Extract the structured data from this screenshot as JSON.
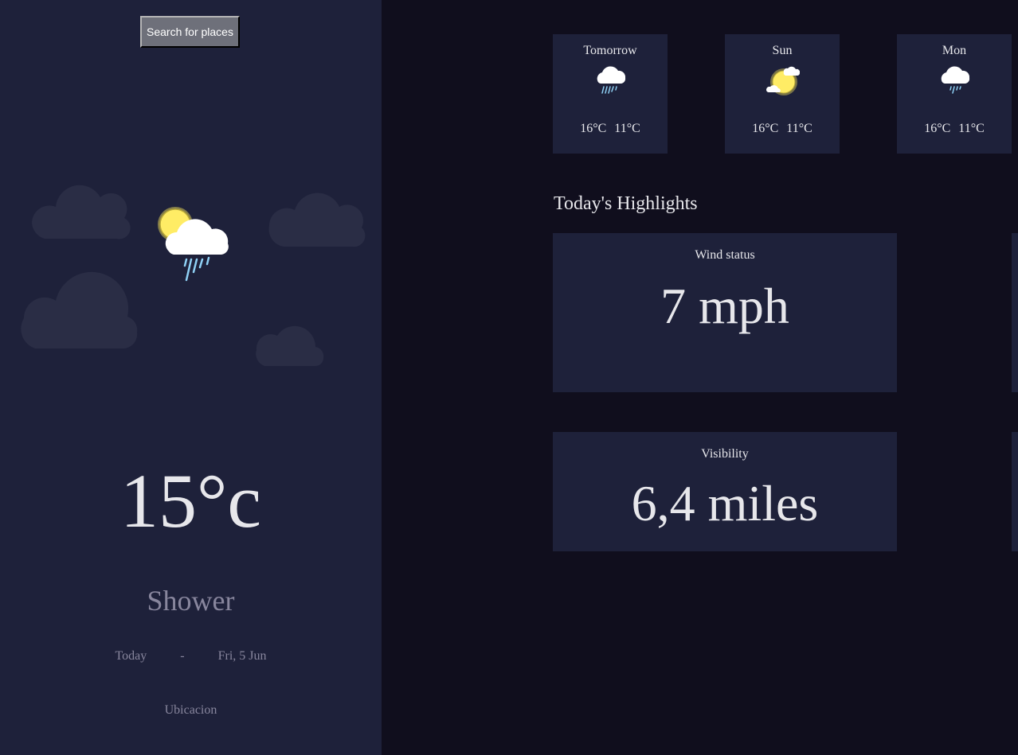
{
  "search": {
    "button_label": "Search for places"
  },
  "current": {
    "icon": "shower-icon",
    "temperature": "15°c",
    "condition": "Shower",
    "date_label": "Today",
    "date_separator": "-",
    "date": "Fri, 5 Jun",
    "location": "Ubicacion"
  },
  "forecast": [
    {
      "day": "Tomorrow",
      "icon": "shower-icon",
      "max": "16°C",
      "min": "11°C"
    },
    {
      "day": "Sun",
      "icon": "light-cloud-sun-icon",
      "max": "16°C",
      "min": "11°C"
    },
    {
      "day": "Mon",
      "icon": "light-rain-icon",
      "max": "16°C",
      "min": "11°C"
    }
  ],
  "highlights": {
    "title": "Today's Highlights",
    "wind": {
      "label": "Wind status",
      "value": "7 mph"
    },
    "visibility": {
      "label": "Visibility",
      "value": "6,4 miles"
    }
  },
  "colors": {
    "sidebar_bg": "#1e213a",
    "page_bg": "#100e1d",
    "card_bg": "#1e213a",
    "text_primary": "#e7e7eb",
    "text_secondary": "#88869d",
    "sun": "#ffec65",
    "rain": "#8fd1f5"
  }
}
